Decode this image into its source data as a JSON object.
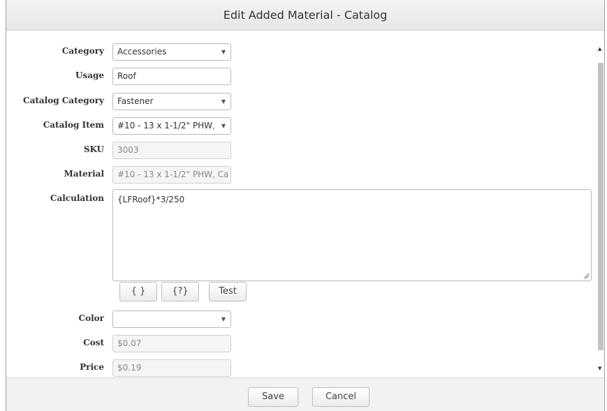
{
  "dialog": {
    "title": "Edit Added Material - Catalog"
  },
  "form": {
    "category": {
      "label": "Category",
      "value": "Accessories"
    },
    "usage": {
      "label": "Usage",
      "value": "Roof"
    },
    "catalog_category": {
      "label": "Catalog Category",
      "value": "Fastener"
    },
    "catalog_item": {
      "label": "Catalog Item",
      "value": "#10 - 13 x 1-1/2\" PHW, Ca"
    },
    "sku": {
      "label": "SKU",
      "value": "3003"
    },
    "material": {
      "label": "Material",
      "value": "#10 - 13 x 1-1/2\" PHW, Ca"
    },
    "calculation": {
      "label": "Calculation",
      "value": "{LFRoof}*3/250"
    },
    "calc_buttons": {
      "braces": "{ }",
      "help": "{?}",
      "test": "Test"
    },
    "color": {
      "label": "Color",
      "value": ""
    },
    "cost": {
      "label": "Cost",
      "value": "$0.07"
    },
    "price": {
      "label": "Price",
      "value": "$0.19"
    }
  },
  "footer": {
    "save_label": "Save",
    "cancel_label": "Cancel"
  },
  "icons": {
    "dropdown": "caret-down-icon",
    "scroll_up": "scroll-up-arrow-icon",
    "scroll_down": "scroll-down-arrow-icon",
    "resize": "resize-grip-icon"
  }
}
